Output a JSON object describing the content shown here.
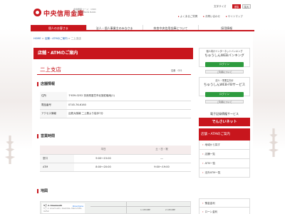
{
  "header": {
    "logo": "中央信用金庫",
    "logo_sub": "金融機関コード：1583\nCHUO SHINKIN BANK",
    "font_size_label": "文字サイズ",
    "font_small": "標準",
    "font_large": "拡大",
    "util_links": [
      "よくあるご質問",
      "お問い合わせ",
      "サイトマップ"
    ]
  },
  "nav": {
    "items": [
      "個人のお客さま",
      "法人・個人事業主のみなさま",
      "奈良中央信用金庫について",
      "採用情報"
    ],
    "active": 0
  },
  "breadcrumb": {
    "home": "HOME",
    "sep": ">",
    "mid": "店舗・ATMのご案内",
    "current": "二上支店"
  },
  "page": {
    "header": "店舗・ATMのご案内",
    "branch_name": "二上支店",
    "store_code": "店番　021"
  },
  "info": {
    "title": "店舗情報",
    "rows": [
      {
        "label": "住所",
        "value": "〒639-0252 奈良県香芝市北旅蛇磯地(1)"
      },
      {
        "label": "電話番号",
        "value": "0745-76-6160"
      },
      {
        "label": "アクセス情報",
        "value": "近鉄大阪線 二上駅より徒歩7分"
      }
    ]
  },
  "hours": {
    "title": "営業時間",
    "head": [
      "",
      "平日",
      "土・日・祝"
    ],
    "rows": [
      {
        "label": "窓口",
        "weekday": "9:00～15:00",
        "weekend": "―"
      },
      {
        "label": "ATM",
        "weekday": "8:00～20:00",
        "weekend": "9:00～19:00"
      }
    ]
  },
  "map": {
    "title": "地図",
    "popup_title": "5丁-1 Anamushi",
    "popup_sub": "5丁-1 Anamushi, Kashiba, Nara 639-0252",
    "popup_directions": "Directions",
    "label1": "1 CHOME",
    "label2": "2 CHOME"
  },
  "sidebar": {
    "banner1_cap": "個人向けインターネットバンキング",
    "banner1_name": "ちゅうしんWEBバンキング",
    "banner1_btn": "ログイン",
    "banner1_sub": "ご利用について",
    "banner2_cap": "法人・事業主向け",
    "banner2_name": "ちゅうしんWEB-FBサービス",
    "banner2_btn": "ログイン",
    "banner2_sub": "ご利用について",
    "elec_cap": "電子記録債権サービス",
    "dense_bar": "でんさいネット",
    "menu_head": "店舗・ATMのご案内",
    "menu_items": [
      "地域から探す",
      "店舗一覧",
      "ATM一覧",
      "法外ATM一覧"
    ],
    "menu2_items": [
      "預金金利",
      "ローン金利"
    ]
  },
  "colors": {
    "brand_red": "#c8161d",
    "login_green": "#2d9b3e"
  }
}
